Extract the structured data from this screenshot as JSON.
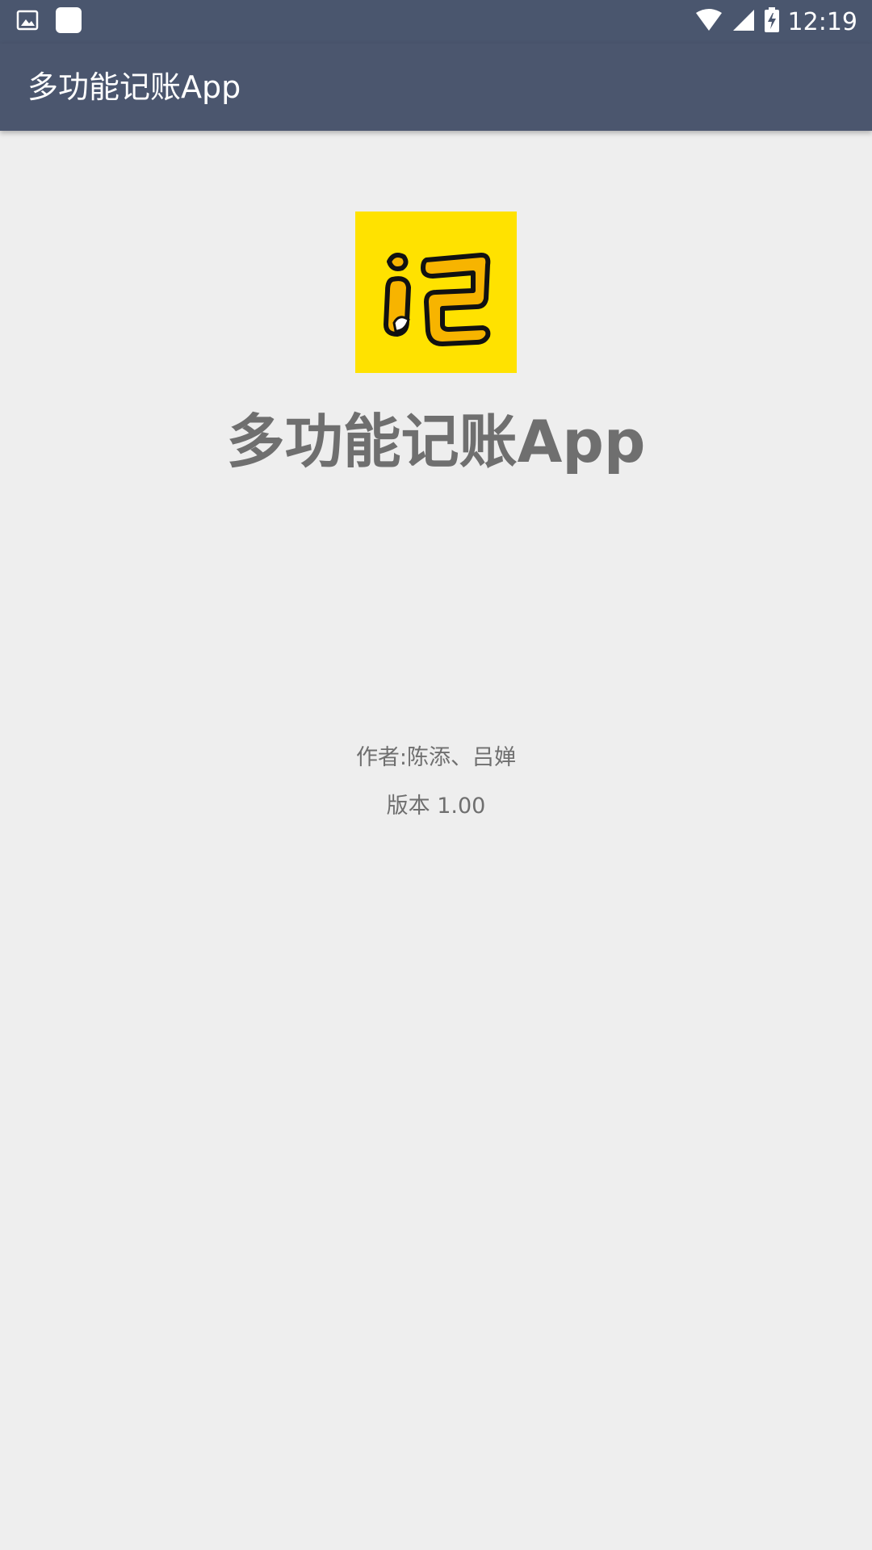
{
  "status_bar": {
    "time": "12:19",
    "icons": [
      "image-notification-icon",
      "app-notification-icon",
      "wifi-icon",
      "signal-icon",
      "battery-charging-icon"
    ]
  },
  "app_bar": {
    "title": "多功能记账App"
  },
  "about": {
    "logo_text": "记",
    "app_name": "多功能记账App",
    "author": "作者:陈添、吕婵",
    "version": "版本 1.00"
  },
  "colors": {
    "app_bar": "#4b566e",
    "background": "#eeeeee",
    "logo_background": "#ffe200",
    "text_gray": "#6f6f6f"
  }
}
